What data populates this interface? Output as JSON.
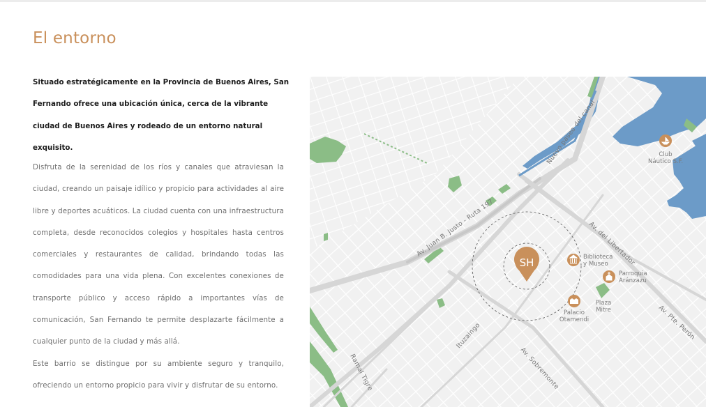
{
  "section": {
    "title": "El entorno",
    "lead": "Situado estratégicamente en la Provincia de Buenos Aires, San Fernando ofrece una ubicación única, cerca de la vibrante ciudad de Buenos Aires y rodeado de un entorno natural exquisito.",
    "paragraph1": "Disfruta de la serenidad de los ríos y canales que atraviesan la ciudad, creando un paisaje idílico y propicio para actividades al aire libre y deportes acuáticos. La ciudad cuenta con una infraestructura completa, desde reconocidos colegios y hospitales hasta centros comerciales y restaurantes de calidad, brindando todas las comodidades para una vida plena. Con excelentes conexiones de transporte público y acceso rápido a importantes vías de comunicación, San Fernando te permite desplazarte fácilmente a cualquier punto de la ciudad y más allá.",
    "paragraph2": "Este barrio se distingue por su ambiente seguro y tranquilo, ofreciendo un entorno propicio para vivir y disfrutar de su entorno."
  },
  "map": {
    "marker_label": "SH",
    "colors": {
      "accent": "#c9905b",
      "water": "#6c9bc8",
      "park": "#8bbd86",
      "land": "#f1f1f1",
      "road": "#d6d6d6"
    },
    "streets": {
      "juan_b_justo": "Av. Juan B. Justo - Ruta 197",
      "nuevo_paseo": "Nuevo paseo del canal",
      "libertador": "Av. del Libertador",
      "pte_peron": "Av. Pte. Perón",
      "sobremonte": "Av. Sobremonte",
      "ituzaingo": "Ituzaingo",
      "ramal_tigre": "Ramal Tigre"
    },
    "pois": {
      "club_line1": "Club",
      "club_line2": "Náutico S.F.",
      "biblioteca_line1": "Biblioteca",
      "biblioteca_line2": "y Museo",
      "parroquia_line1": "Parroquia",
      "parroquia_line2": "Aránzazu",
      "plaza_line1": "Plaza",
      "plaza_line2": "Mitre",
      "palacio_line1": "Palacio",
      "palacio_line2": "Otamendi"
    }
  }
}
